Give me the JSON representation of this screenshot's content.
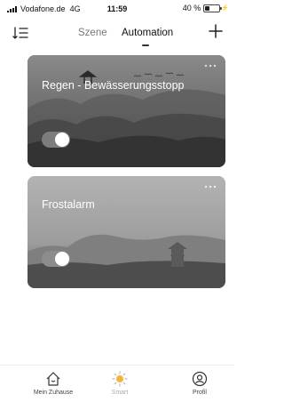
{
  "status": {
    "carrier": "Vodafone.de",
    "network": "4G",
    "time": "11:59",
    "battery": "40 %",
    "battery_level": 0.4
  },
  "header": {
    "tabs": [
      {
        "label": "Szene",
        "active": false
      },
      {
        "label": "Automation",
        "active": true
      }
    ],
    "icons": {
      "left": "sort-icon",
      "right": "add-icon"
    }
  },
  "automations": [
    {
      "title": "Regen - Bewässerungsstopp",
      "enabled": true,
      "menu_icon": "more-icon"
    },
    {
      "title": "Frostalarm",
      "enabled": true,
      "menu_icon": "more-icon"
    }
  ],
  "tabbar": {
    "items": [
      {
        "label": "Mein Zuhause",
        "icon": "home-icon",
        "active": false
      },
      {
        "label": "Smart",
        "icon": "smart-icon",
        "active": false
      },
      {
        "label": "Profil",
        "icon": "profile-icon",
        "active": false
      }
    ]
  },
  "colors": {
    "smart_accent": "#f3b43b",
    "card1_bg": "#6b6b6b",
    "card2_bg": "#a8a8a8"
  }
}
